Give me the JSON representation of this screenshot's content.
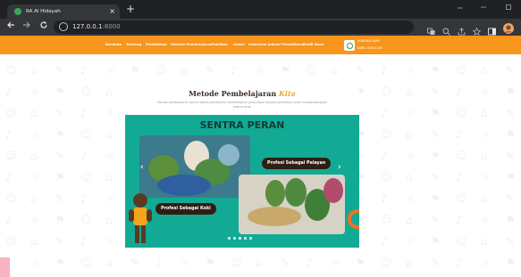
{
  "browser": {
    "tab_title": "RA Al Hidayah",
    "tab_close": "×",
    "new_tab": "+",
    "url_host": "127.0.0.1",
    "url_port": ":8000",
    "nav_icons": [
      "back-arrow-icon",
      "forward-arrow-icon",
      "reload-icon"
    ],
    "toolbar_icons": [
      "translate-icon",
      "zoom-icon",
      "share-icon",
      "bookmark-star-icon",
      "sidebar-icon",
      "profile-avatar-icon"
    ],
    "window_controls": [
      "minimize-icon",
      "maximize-icon",
      "close-window-icon"
    ]
  },
  "site_nav": {
    "links": [
      "Beranda",
      "Tentang",
      "Pendidikan",
      "Metode Pembelajaran",
      "Fasilitas",
      "Galeri",
      "Informasi Jadwal Pendaftaran",
      "Profil Guru"
    ],
    "contact_label": "HUBUNGI KAMI",
    "contact_phone": "0896-7859-4158",
    "nav_color": "#f7951d"
  },
  "slider": {
    "heading": "Metode Pembelajaran",
    "heading_accent": "Kita",
    "description": "Metode pembelajaran sentra adalah pendekatan pembelajaran yang dapat dipakai pendidikan untuk mengembangkan potensi anak",
    "title": "SENTRA PERAN",
    "caption_1": "Profesi Sebagai Pelayan",
    "caption_2": "Profesi Sebagai Koki",
    "prev_arrow": "‹",
    "next_arrow": "›",
    "slide_count": 5,
    "active_slide": 3,
    "bg_color": "#12aa94",
    "accent_color": "#f5a623"
  }
}
